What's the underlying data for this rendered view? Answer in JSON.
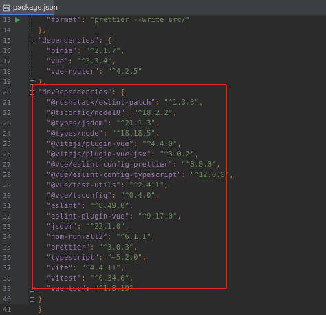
{
  "tab": {
    "label": "package.json",
    "icon": "json-file-icon"
  },
  "colors": {
    "background": "#2b2b2b",
    "key": "#9876aa",
    "string": "#6a8759",
    "punctuation": "#cc7832",
    "highlight": "#e0271f"
  },
  "lines": [
    {
      "n": "13",
      "key": "\"format\"",
      "sep": ": ",
      "val": "\"prettier --write src/\"",
      "end": ""
    },
    {
      "n": "14",
      "text": "},"
    },
    {
      "n": "15",
      "key": "\"dependencies\"",
      "sep": ": ",
      "val": "",
      "end": "{"
    },
    {
      "n": "16",
      "key": "\"pinia\"",
      "sep": ": ",
      "val": "\"^2.1.7\"",
      "end": ","
    },
    {
      "n": "17",
      "key": "\"vue\"",
      "sep": ": ",
      "val": "\"^3.3.4\"",
      "end": ","
    },
    {
      "n": "18",
      "key": "\"vue-router\"",
      "sep": ": ",
      "val": "\"^4.2.5\"",
      "end": ""
    },
    {
      "n": "19",
      "text": "},"
    },
    {
      "n": "20",
      "key": "\"devDependencies\"",
      "sep": ": ",
      "val": "",
      "end": "{"
    },
    {
      "n": "21",
      "key": "\"@rushstack/eslint-patch\"",
      "sep": ": ",
      "val": "\"^1.3.3\"",
      "end": ","
    },
    {
      "n": "22",
      "key": "\"@tsconfig/node18\"",
      "sep": ": ",
      "val": "\"^18.2.2\"",
      "end": ","
    },
    {
      "n": "23",
      "key": "\"@types/jsdom\"",
      "sep": ": ",
      "val": "\"^21.1.3\"",
      "end": ","
    },
    {
      "n": "24",
      "key": "\"@types/node\"",
      "sep": ": ",
      "val": "\"^18.18.5\"",
      "end": ","
    },
    {
      "n": "25",
      "key": "\"@vitejs/plugin-vue\"",
      "sep": ": ",
      "val": "\"^4.4.0\"",
      "end": ","
    },
    {
      "n": "26",
      "key": "\"@vitejs/plugin-vue-jsx\"",
      "sep": ": ",
      "val": "\"^3.0.2\"",
      "end": ","
    },
    {
      "n": "27",
      "key": "\"@vue/eslint-config-prettier\"",
      "sep": ": ",
      "val": "\"^8.0.0\"",
      "end": ","
    },
    {
      "n": "28",
      "key": "\"@vue/eslint-config-typescript\"",
      "sep": ": ",
      "val": "\"^12.0.0\"",
      "end": ","
    },
    {
      "n": "29",
      "key": "\"@vue/test-utils\"",
      "sep": ": ",
      "val": "\"^2.4.1\"",
      "end": ","
    },
    {
      "n": "30",
      "key": "\"@vue/tsconfig\"",
      "sep": ": ",
      "val": "\"^0.4.0\"",
      "end": ","
    },
    {
      "n": "31",
      "key": "\"eslint\"",
      "sep": ": ",
      "val": "\"^8.49.0\"",
      "end": ","
    },
    {
      "n": "32",
      "key": "\"eslint-plugin-vue\"",
      "sep": ": ",
      "val": "\"^9.17.0\"",
      "end": ","
    },
    {
      "n": "33",
      "key": "\"jsdom\"",
      "sep": ": ",
      "val": "\"^22.1.0\"",
      "end": ","
    },
    {
      "n": "34",
      "key": "\"npm-run-all2\"",
      "sep": ": ",
      "val": "\"^6.1.1\"",
      "end": ","
    },
    {
      "n": "35",
      "key": "\"prettier\"",
      "sep": ": ",
      "val": "\"^3.0.3\"",
      "end": ","
    },
    {
      "n": "36",
      "key": "\"typescript\"",
      "sep": ": ",
      "val": "\"~5.2.0\"",
      "end": ","
    },
    {
      "n": "37",
      "key": "\"vite\"",
      "sep": ": ",
      "val": "\"^4.4.11\"",
      "end": ","
    },
    {
      "n": "38",
      "key": "\"vitest\"",
      "sep": ": ",
      "val": "\"^0.34.6\"",
      "end": ","
    },
    {
      "n": "39",
      "key": "\"vue-tsc\"",
      "sep": ": ",
      "val": "\"^1.8.19\"",
      "end": ""
    },
    {
      "n": "40",
      "text": "}"
    },
    {
      "n": "41",
      "text": "}"
    }
  ]
}
